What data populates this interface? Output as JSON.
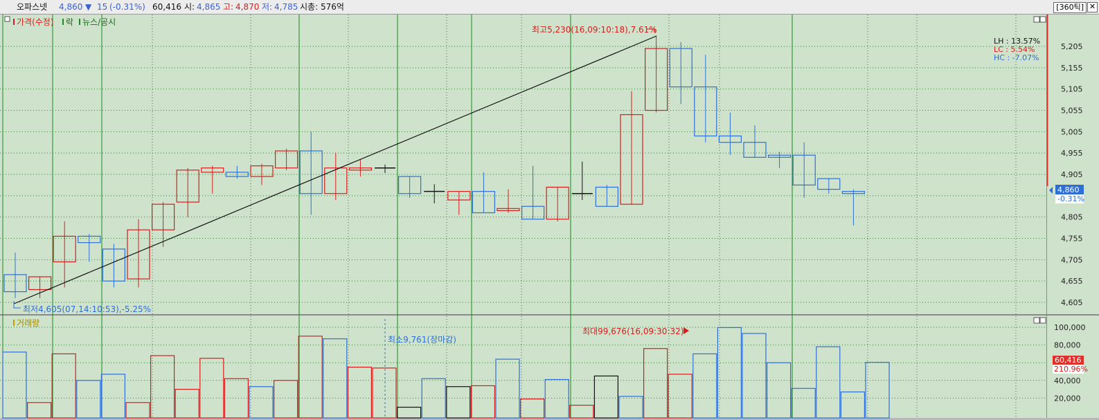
{
  "header": {
    "name": "오파스넷",
    "price": "4,860",
    "change_arrow": "▼",
    "change": "15",
    "change_pct": "(-0.31%)",
    "volume": "60,416",
    "open_label": "시:",
    "open": "4,865",
    "high_label": "고:",
    "high": "4,870",
    "low_label": "저:",
    "low": "4,785",
    "mcap_label": "시총:",
    "mcap": "576억",
    "period": "[360틱]",
    "close_icon": "close-icon"
  },
  "price_panel": {
    "legend_price": "가격(수정)",
    "legend_rak": "락",
    "legend_news": "뉴스/공시",
    "max_note": "최고5,230(16,09:10:18),7.61%",
    "min_note": "최저4,605(07,14:10:53),-5.25%",
    "lh": "LH : 13.57%",
    "lc": "LC :  5.54%",
    "hc": "HC : -7.07%",
    "price_tag": "4,860",
    "pct_tag": "-0.31%"
  },
  "volume_panel": {
    "legend": "거래량",
    "max_note": "최대99,676(16,09:30:32)",
    "min_note": "최소9,761(장마감)",
    "vol_tag": "60,416",
    "pct_tag": "210.96%"
  },
  "colors": {
    "up": "#d81c1c",
    "down": "#2e6fd6",
    "flat": "#111111",
    "grid_green": "#1a8a1a",
    "background": "#cfe3cc"
  },
  "chart_data": {
    "type": "candlestick",
    "ylim": [
      4580,
      5240
    ],
    "y_ticks": [
      "5,205",
      "5,155",
      "5,105",
      "5,055",
      "5,005",
      "4,955",
      "4,905",
      "4,855",
      "4,805",
      "4,755",
      "4,705",
      "4,655",
      "4,605"
    ],
    "candles": [
      {
        "o": 4670,
        "h": 4722,
        "l": 4615,
        "c": 4630
      },
      {
        "o": 4635,
        "h": 4665,
        "l": 4615,
        "c": 4665
      },
      {
        "o": 4700,
        "h": 4795,
        "l": 4640,
        "c": 4760
      },
      {
        "o": 4760,
        "h": 4765,
        "l": 4700,
        "c": 4745
      },
      {
        "o": 4730,
        "h": 4742,
        "l": 4640,
        "c": 4655
      },
      {
        "o": 4660,
        "h": 4800,
        "l": 4640,
        "c": 4775
      },
      {
        "o": 4775,
        "h": 4840,
        "l": 4735,
        "c": 4835
      },
      {
        "o": 4840,
        "h": 4920,
        "l": 4805,
        "c": 4915
      },
      {
        "o": 4910,
        "h": 4925,
        "l": 4860,
        "c": 4920
      },
      {
        "o": 4910,
        "h": 4925,
        "l": 4895,
        "c": 4900
      },
      {
        "o": 4900,
        "h": 4930,
        "l": 4880,
        "c": 4925
      },
      {
        "o": 4920,
        "h": 4965,
        "l": 4915,
        "c": 4960
      },
      {
        "o": 4960,
        "h": 5005,
        "l": 4810,
        "c": 4860
      },
      {
        "o": 4860,
        "h": 4955,
        "l": 4845,
        "c": 4920
      },
      {
        "o": 4915,
        "h": 4940,
        "l": 4900,
        "c": 4920
      },
      {
        "o": 4920,
        "h": 4928,
        "l": 4908,
        "c": 4920
      },
      {
        "o": 4900,
        "h": 4900,
        "l": 4850,
        "c": 4860
      },
      {
        "o": 4865,
        "h": 4882,
        "l": 4837,
        "c": 4865
      },
      {
        "o": 4845,
        "h": 4865,
        "l": 4810,
        "c": 4865
      },
      {
        "o": 4865,
        "h": 4910,
        "l": 4815,
        "c": 4815
      },
      {
        "o": 4820,
        "h": 4870,
        "l": 4815,
        "c": 4825
      },
      {
        "o": 4830,
        "h": 4925,
        "l": 4800,
        "c": 4800
      },
      {
        "o": 4800,
        "h": 4875,
        "l": 4795,
        "c": 4875
      },
      {
        "o": 4860,
        "h": 4935,
        "l": 4845,
        "c": 4860
      },
      {
        "o": 4875,
        "h": 4880,
        "l": 4830,
        "c": 4830
      },
      {
        "o": 4835,
        "h": 5100,
        "l": 4835,
        "c": 5045
      },
      {
        "o": 5055,
        "h": 5230,
        "l": 5050,
        "c": 5200
      },
      {
        "o": 5200,
        "h": 5215,
        "l": 5070,
        "c": 5110
      },
      {
        "o": 5110,
        "h": 5185,
        "l": 4980,
        "c": 4995
      },
      {
        "o": 4995,
        "h": 5050,
        "l": 4950,
        "c": 4980
      },
      {
        "o": 4980,
        "h": 5020,
        "l": 4945,
        "c": 4945
      },
      {
        "o": 4950,
        "h": 4958,
        "l": 4920,
        "c": 4945
      },
      {
        "o": 4950,
        "h": 4980,
        "l": 4850,
        "c": 4880
      },
      {
        "o": 4895,
        "h": 4895,
        "l": 4860,
        "c": 4870
      },
      {
        "o": 4865,
        "h": 4870,
        "l": 4785,
        "c": 4860
      }
    ],
    "volume": {
      "ylim": [
        0,
        110000
      ],
      "y_ticks": [
        "100,000",
        "80,000",
        "60,000",
        "40,000",
        "20,000"
      ],
      "values": [
        72000,
        15000,
        70000,
        40000,
        47000,
        15000,
        68000,
        30000,
        65000,
        42000,
        33000,
        40000,
        90000,
        87000,
        55000,
        54000,
        9761,
        42000,
        33000,
        34000,
        64000,
        19000,
        41000,
        12000,
        45000,
        22000,
        76000,
        47000,
        70000,
        99676,
        93000,
        60000,
        31000,
        78000,
        27000,
        60416
      ]
    }
  }
}
